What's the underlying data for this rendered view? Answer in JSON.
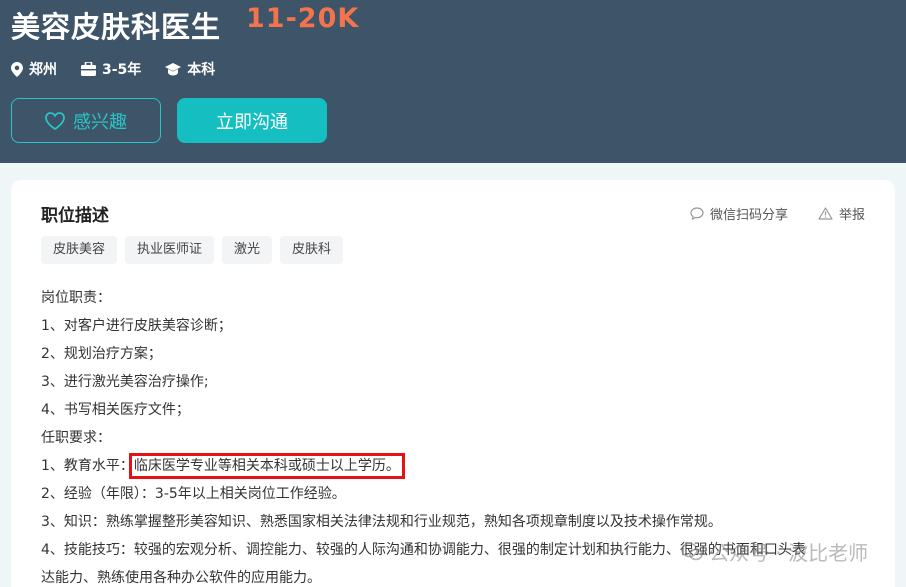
{
  "job": {
    "title": "美容皮肤科医生",
    "salary": "11-20K",
    "location": "郑州",
    "experience": "3-5年",
    "education": "本科"
  },
  "buttons": {
    "interest": "感兴趣",
    "chat": "立即沟通"
  },
  "card": {
    "title": "职位描述",
    "share": "微信扫码分享",
    "report": "举报",
    "tags": [
      "皮肤美容",
      "执业医师证",
      "激光",
      "皮肤科"
    ]
  },
  "description": {
    "line1": "岗位职责：",
    "line2": "1、对客户进行皮肤美容诊断；",
    "line3": "2、规划治疗方案；",
    "line4": "3、进行激光美容治疗操作;",
    "line5": "4、书写相关医疗文件；",
    "line6": "任职要求：",
    "line7_prefix": "1、教育水平：",
    "line7_highlight": "临床医学专业等相关本科或硕士以上学历。",
    "line8": "2、经验（年限）：3-5年以上相关岗位工作经验。",
    "line9": "3、知识：熟练掌握整形美容知识、熟悉国家相关法律法规和行业规范，熟知各项规章制度以及技术操作常规。",
    "line10": "4、技能技巧：较强的宏观分析、调控能力、较强的人际沟通和协调能力、很强的制定计划和执行能力、很强的书面和口头表",
    "line11": "达能力、熟练使用各种办公软件的应用能力。"
  },
  "watermark": {
    "text": "公众号 · 波比老师"
  },
  "colors": {
    "header_bg": "#3e5468",
    "salary": "#f3734d",
    "accent": "#15bfc1",
    "highlight_box": "#e41212"
  }
}
